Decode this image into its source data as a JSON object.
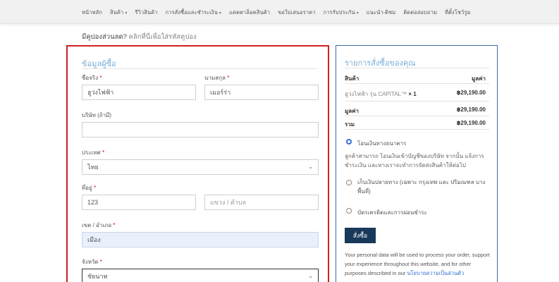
{
  "nav": [
    {
      "label": "หน้าหลัก",
      "has_dropdown": false
    },
    {
      "label": "สินค้า",
      "has_dropdown": true
    },
    {
      "label": "รีวิวสินค้า",
      "has_dropdown": false
    },
    {
      "label": "การสั่งซื้อและชำระเงิน",
      "has_dropdown": true
    },
    {
      "label": "แคตตาล็อคสินค้า",
      "has_dropdown": false
    },
    {
      "label": "ขอใบเสนอราคา",
      "has_dropdown": false
    },
    {
      "label": "การรับประกัน",
      "has_dropdown": true
    },
    {
      "label": "แนะนำ-ติชม",
      "has_dropdown": false
    },
    {
      "label": "ติดต่อสอบถาม",
      "has_dropdown": false
    },
    {
      "label": "ที่ตั้งโชว์รูม",
      "has_dropdown": false
    }
  ],
  "coupon": {
    "text": "มีคูปองส่วนลด?",
    "link": "คลิกที่นี่เพื่อใส่รหัสคูปอง"
  },
  "billing": {
    "title": "ข้อมูลผู้ซื้อ",
    "first_name": {
      "label": "ชื่อจริง",
      "value": "ฮูว่งไฟฟ้า"
    },
    "last_name": {
      "label": "นามสกุล",
      "value": "เมอร์ร่า"
    },
    "company": {
      "label": "บริษัท (ถ้ามี)",
      "value": ""
    },
    "country": {
      "label": "ประเทศ",
      "value": "ไทย"
    },
    "address": {
      "label": "ที่อยู่",
      "value": "123",
      "placeholder2": "แขวง / ตำบล"
    },
    "district": {
      "label": "เขต / อำเภอ",
      "value": "เมือง"
    },
    "province": {
      "label": "จังหวัด",
      "value": "ชัยนาท"
    },
    "required_mark": "*"
  },
  "order": {
    "title": "รายการสั่งซื้อของคุณ",
    "col_product": "สินค้า",
    "col_total": "มูลค่า",
    "item_name": "ฮูว่งไฟฟ้า รุ่น CAPITAL™",
    "item_qty": "× 1",
    "item_price": "฿29,190.00",
    "subtotal_label": "มูลค่า",
    "subtotal": "฿29,190.00",
    "total_label": "รวม",
    "total": "฿29,190.00",
    "payment": {
      "bank": "โอนเงินทางธนาคาร",
      "bank_desc": "ลูกค้าสามารถ โอนเงินเข้าบัญชีของบริษัท จากนั้น แจ้งการชำระเงิน และทางเราจะทำการจัดส่งสินค้าให้ต่อไป",
      "cod": "เก็บเงินปลายทาง (เฉพาะ กรุงเทพ และ ปริมณฑล บางพื้นที่)",
      "card": "บัตรเครดิตและการผ่อนชำระ"
    },
    "place_order": "สั่งซื้อ",
    "privacy_text": "Your personal data will be used to process your order, support your experience throughout this website, and for other purposes described in our",
    "privacy_link": "นโยบายความเป็นส่วนตัว"
  },
  "colors": {
    "accent": "#7aaed6",
    "highlight_border": "#d31f1f",
    "button": "#18395a",
    "order_border": "#3d6ea3"
  }
}
